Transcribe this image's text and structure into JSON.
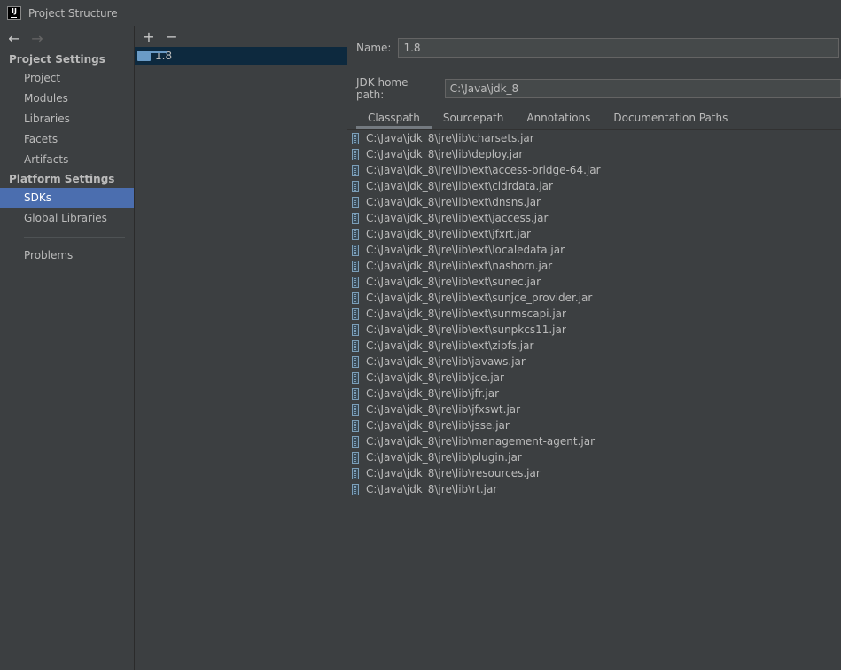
{
  "window": {
    "title": "Project Structure",
    "logo_text": "IJ"
  },
  "nav": {
    "back": "←",
    "forward": "→"
  },
  "sidebar": {
    "project_settings_header": "Project Settings",
    "project_items": [
      "Project",
      "Modules",
      "Libraries",
      "Facets",
      "Artifacts"
    ],
    "platform_settings_header": "Platform Settings",
    "platform_items": [
      "SDKs",
      "Global Libraries"
    ],
    "selected": "SDKs",
    "problems": "Problems"
  },
  "sdk_list": {
    "add": "+",
    "remove": "−",
    "items": [
      {
        "label": "1.8",
        "icon": "folder-icon"
      }
    ]
  },
  "detail": {
    "name_label": "Name:",
    "name_value": "1.8",
    "jdk_home_label": "JDK home path:",
    "jdk_home_value": "C:\\Java\\jdk_8",
    "tabs": [
      "Classpath",
      "Sourcepath",
      "Annotations",
      "Documentation Paths"
    ],
    "active_tab": "Classpath",
    "classpath": [
      "C:\\Java\\jdk_8\\jre\\lib\\charsets.jar",
      "C:\\Java\\jdk_8\\jre\\lib\\deploy.jar",
      "C:\\Java\\jdk_8\\jre\\lib\\ext\\access-bridge-64.jar",
      "C:\\Java\\jdk_8\\jre\\lib\\ext\\cldrdata.jar",
      "C:\\Java\\jdk_8\\jre\\lib\\ext\\dnsns.jar",
      "C:\\Java\\jdk_8\\jre\\lib\\ext\\jaccess.jar",
      "C:\\Java\\jdk_8\\jre\\lib\\ext\\jfxrt.jar",
      "C:\\Java\\jdk_8\\jre\\lib\\ext\\localedata.jar",
      "C:\\Java\\jdk_8\\jre\\lib\\ext\\nashorn.jar",
      "C:\\Java\\jdk_8\\jre\\lib\\ext\\sunec.jar",
      "C:\\Java\\jdk_8\\jre\\lib\\ext\\sunjce_provider.jar",
      "C:\\Java\\jdk_8\\jre\\lib\\ext\\sunmscapi.jar",
      "C:\\Java\\jdk_8\\jre\\lib\\ext\\sunpkcs11.jar",
      "C:\\Java\\jdk_8\\jre\\lib\\ext\\zipfs.jar",
      "C:\\Java\\jdk_8\\jre\\lib\\javaws.jar",
      "C:\\Java\\jdk_8\\jre\\lib\\jce.jar",
      "C:\\Java\\jdk_8\\jre\\lib\\jfr.jar",
      "C:\\Java\\jdk_8\\jre\\lib\\jfxswt.jar",
      "C:\\Java\\jdk_8\\jre\\lib\\jsse.jar",
      "C:\\Java\\jdk_8\\jre\\lib\\management-agent.jar",
      "C:\\Java\\jdk_8\\jre\\lib\\plugin.jar",
      "C:\\Java\\jdk_8\\jre\\lib\\resources.jar",
      "C:\\Java\\jdk_8\\jre\\lib\\rt.jar"
    ]
  },
  "colors": {
    "background": "#3c3f41",
    "selection": "#4b6eaf",
    "tree_selection": "#0d293e",
    "text": "#bbbbbb"
  }
}
